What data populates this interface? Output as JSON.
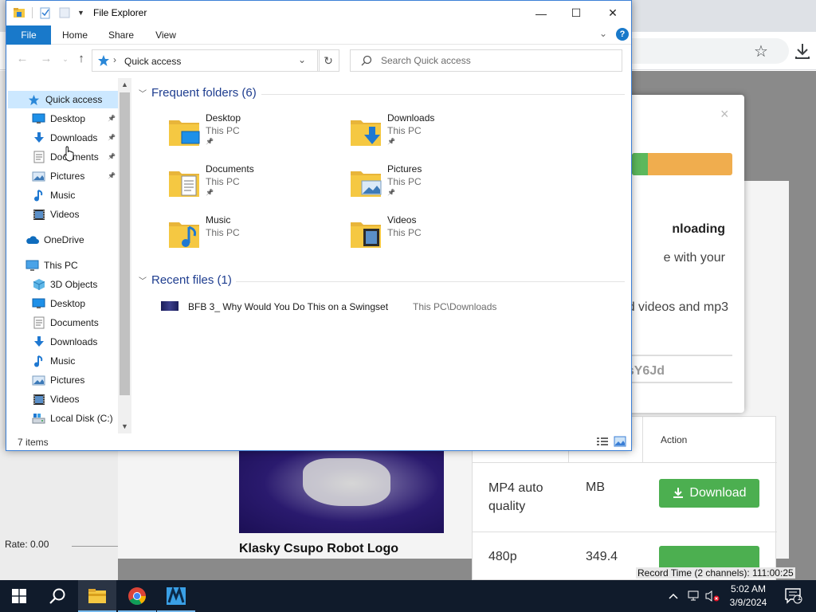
{
  "window": {
    "title": "File Explorer",
    "minimize": "—",
    "maximize": "☐",
    "close": "✕"
  },
  "ribbon": {
    "tabs": [
      "File",
      "Home",
      "Share",
      "View"
    ],
    "help": "?"
  },
  "address": {
    "path": "Quick access",
    "search_placeholder": "Search Quick access"
  },
  "nav_pane": {
    "quick_access": "Quick access",
    "pinned": [
      {
        "label": "Desktop",
        "icon": "desktop-icon"
      },
      {
        "label": "Downloads",
        "icon": "downloads-icon"
      },
      {
        "label": "Documents",
        "icon": "documents-icon"
      },
      {
        "label": "Pictures",
        "icon": "pictures-icon"
      }
    ],
    "unpinned": [
      {
        "label": "Music",
        "icon": "music-icon"
      },
      {
        "label": "Videos",
        "icon": "videos-icon"
      }
    ],
    "onedrive": "OneDrive",
    "this_pc": "This PC",
    "this_pc_items": [
      {
        "label": "3D Objects",
        "icon": "3d-objects-icon"
      },
      {
        "label": "Desktop",
        "icon": "desktop-icon"
      },
      {
        "label": "Documents",
        "icon": "documents-icon"
      },
      {
        "label": "Downloads",
        "icon": "downloads-icon"
      },
      {
        "label": "Music",
        "icon": "music-icon"
      },
      {
        "label": "Pictures",
        "icon": "pictures-icon"
      },
      {
        "label": "Videos",
        "icon": "videos-icon"
      },
      {
        "label": "Local Disk (C:)",
        "icon": "local-disk-icon"
      }
    ]
  },
  "content": {
    "frequent_header": "Frequent folders (6)",
    "frequent": [
      {
        "name": "Desktop",
        "location": "This PC",
        "pinned": true
      },
      {
        "name": "Downloads",
        "location": "This PC",
        "pinned": true
      },
      {
        "name": "Documents",
        "location": "This PC",
        "pinned": true
      },
      {
        "name": "Pictures",
        "location": "This PC",
        "pinned": true
      },
      {
        "name": "Music",
        "location": "This PC",
        "pinned": false
      },
      {
        "name": "Videos",
        "location": "This PC",
        "pinned": false
      }
    ],
    "recent_header": "Recent files (1)",
    "recent": [
      {
        "name": "BFB 3_ Why Would You Do This on a Swingset",
        "path": "This PC\\Downloads"
      }
    ]
  },
  "status": {
    "item_count": "7 items"
  },
  "background_page": {
    "modal_heading_fragment": "nloading",
    "modal_line1_fragment": "e with your",
    "modal_line2_fragment": "d videos and mp3",
    "modal_code_fragment": "sY6Jd",
    "modal_progress_fraction": 0.16,
    "table_action_header": "Action",
    "row1_quality": "MP4 auto quality",
    "row1_size": "MB",
    "row1_button": "Download",
    "row2_quality": "480p",
    "row2_size": "349.4",
    "video_title": "Klasky Csupo Robot Logo",
    "rate_label": "Rate: 0.00",
    "record_time": "Record Time (2 channels): 111:00:25"
  },
  "taskbar": {
    "time": "5:02 AM",
    "date": "3/9/2024",
    "notifications_count": "1"
  },
  "colors": {
    "accent": "#1979ca",
    "selection": "#cce8ff",
    "taskbar": "#101b2b",
    "folder_yellow": "#f5c842",
    "download_green": "#4caf50"
  }
}
